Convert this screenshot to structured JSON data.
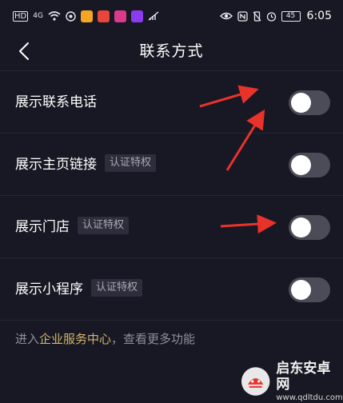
{
  "status_bar": {
    "left_indicators": [
      "HD",
      "4G"
    ],
    "time": "6:05",
    "battery": "45",
    "app_icon_colors": [
      "#f5a623",
      "#e8453c",
      "#d93a8a",
      "#8b3cf0"
    ]
  },
  "header": {
    "title": "联系方式",
    "back_icon": "chevron-left-icon"
  },
  "settings": [
    {
      "label": "展示联系电话",
      "badge": "",
      "enabled": false
    },
    {
      "label": "展示主页链接",
      "badge": "认证特权",
      "enabled": false
    },
    {
      "label": "展示门店",
      "badge": "认证特权",
      "enabled": false
    },
    {
      "label": "展示小程序",
      "badge": "认证特权",
      "enabled": false
    }
  ],
  "footer": {
    "prefix": "进入",
    "link": "企业服务中心",
    "suffix": "，查看更多功能"
  },
  "watermark": {
    "main": "启东安卓网",
    "sub": "www.qdltdu.com"
  },
  "colors": {
    "background": "#181824",
    "link": "#d3b66a",
    "toggle_off": "#4c4c58",
    "arrow": "#e8332a"
  }
}
